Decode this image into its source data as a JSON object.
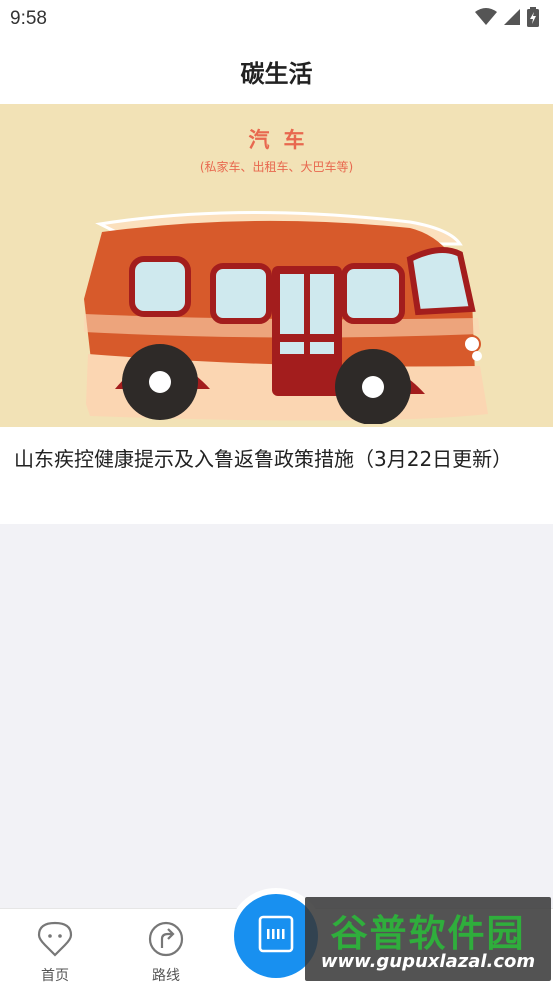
{
  "status_bar": {
    "time": "9:58",
    "icons": [
      "wifi-icon",
      "signal-icon",
      "battery-charging-icon"
    ]
  },
  "header": {
    "title": "碳生活"
  },
  "feed": [
    {
      "banner": {
        "title": "汽车",
        "subtitle": "(私家车、出租车、大巴车等)"
      },
      "text": "山东疾控健康提示及入鲁返鲁政策措施（3月22日更新）"
    }
  ],
  "tab_bar": {
    "tabs": [
      {
        "label": "首页",
        "icon": "location-pin-icon"
      },
      {
        "label": "路线",
        "icon": "route-arrow-icon"
      }
    ],
    "center_button_icon": "scan-icon"
  },
  "watermark": {
    "title": "谷普软件园",
    "url": "www.gupuxlazal.com"
  },
  "colors": {
    "accent": "#1890f0",
    "banner_bg": "#f2e2b6",
    "banner_text": "#e8684f",
    "page_bg": "#f2f2f6"
  }
}
